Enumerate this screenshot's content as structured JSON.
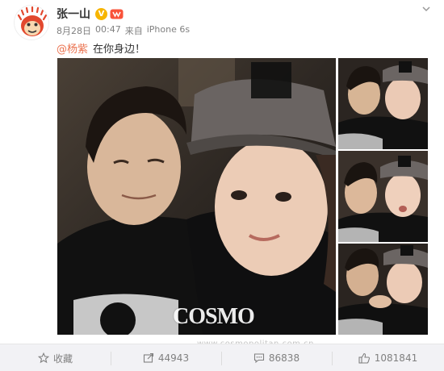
{
  "post": {
    "author": "张一山",
    "date": "8月28日",
    "time": "00:47",
    "source_prefix": "来自",
    "source": "iPhone 6s",
    "mention": "@杨紫",
    "text": "在你身边！"
  },
  "photos": {
    "watermark": "COSMO",
    "footer_url": "www.cosmopolitan.com.cn"
  },
  "actions": {
    "collect_label": "收藏",
    "repost_count": "44943",
    "comment_count": "86838",
    "like_count": "1081841"
  },
  "colors": {
    "mention": "#eb7350",
    "footer_bg": "#f2f2f5",
    "vip_badge": "#f7b500"
  },
  "icons": [
    "avatar-monkey",
    "vip-icon",
    "member-icon",
    "chevron-down-icon",
    "star-icon",
    "repost-icon",
    "comment-icon",
    "like-icon"
  ]
}
